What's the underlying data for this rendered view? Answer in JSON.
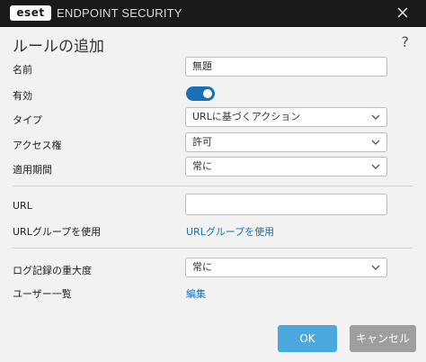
{
  "titlebar": {
    "brand": "eset",
    "product": "ENDPOINT SECURITY"
  },
  "dialog": {
    "title": "ルールの追加",
    "help": "?"
  },
  "form": {
    "name_label": "名前",
    "name_value": "無題",
    "enabled_label": "有効",
    "enabled": true,
    "type_label": "タイプ",
    "type_value": "URLに基づくアクション",
    "access_label": "アクセス権",
    "access_value": "許可",
    "period_label": "適用期間",
    "period_value": "常に",
    "url_label": "URL",
    "url_value": "",
    "url_group_label": "URLグループを使用",
    "url_group_link": "URLグループを使用",
    "log_label": "ログ記録の重大度",
    "log_value": "常に",
    "users_label": "ユーザー一覧",
    "users_link": "編集"
  },
  "buttons": {
    "ok": "OK",
    "cancel": "キャンセル"
  },
  "colors": {
    "titlebar": "#1a1a1a",
    "toggle_on": "#1b6fb5",
    "link": "#1673b9",
    "ok_button": "#4aa8de",
    "cancel_button": "#9e9e9e"
  },
  "icons": {
    "close": "close-icon",
    "help": "help-icon",
    "dropdown": "chevron-down-icon"
  }
}
